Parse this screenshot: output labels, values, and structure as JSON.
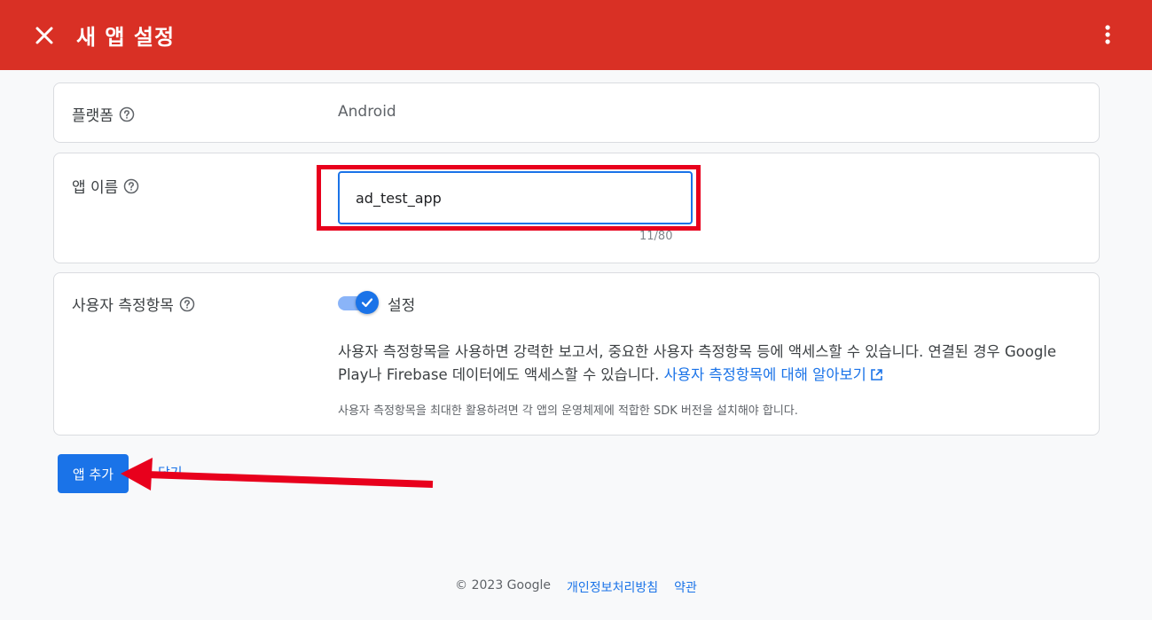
{
  "header": {
    "title": "새 앱 설정"
  },
  "platform": {
    "label": "플랫폼",
    "value": "Android"
  },
  "app_name": {
    "label": "앱 이름",
    "value": "ad_test_app",
    "counter": "11/80"
  },
  "user_metrics": {
    "label": "사용자 측정항목",
    "toggle_label": "설정",
    "toggle_on": true,
    "description": "사용자 측정항목을 사용하면 강력한 보고서, 중요한 사용자 측정항목 등에 액세스할 수 있습니다. 연결된 경우 Google Play나 Firebase 데이터에도 액세스할 수 있습니다. ",
    "learn_more_link": "사용자 측정항목에 대해 알아보기",
    "note": "사용자 측정항목을 최대한 활용하려면 각 앱의 운영체제에 적합한 SDK 버전을 설치해야 합니다."
  },
  "actions": {
    "add_app": "앱 추가",
    "cancel": "닫기"
  },
  "footer": {
    "copyright": "© 2023 Google",
    "privacy": "개인정보처리방침",
    "terms": "약관"
  },
  "colors": {
    "header_bg": "#d93025",
    "accent": "#1a73e8",
    "annotation_red": "#e8001c"
  }
}
